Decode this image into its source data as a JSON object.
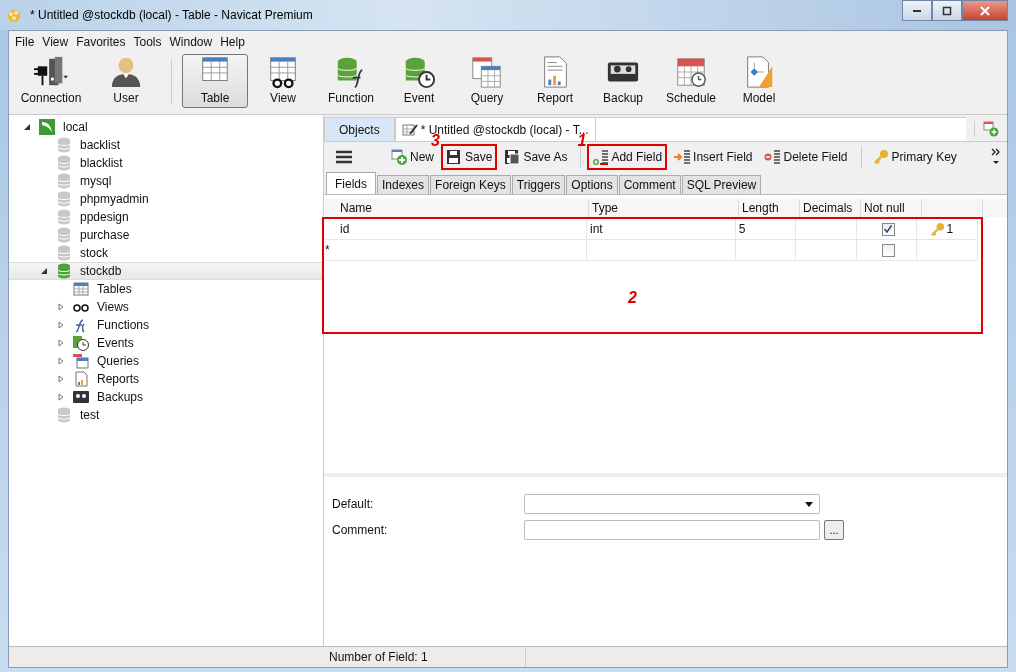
{
  "window": {
    "title": "* Untitled @stockdb (local) - Table - Navicat Premium"
  },
  "menu": [
    "File",
    "View",
    "Favorites",
    "Tools",
    "Window",
    "Help"
  ],
  "toolbar": [
    {
      "label": "Connection",
      "kind": "connection",
      "selected": false
    },
    {
      "label": "User",
      "kind": "user",
      "selected": false
    },
    {
      "label": "Table",
      "kind": "table",
      "selected": true
    },
    {
      "label": "View",
      "kind": "view",
      "selected": false
    },
    {
      "label": "Function",
      "kind": "function",
      "selected": false
    },
    {
      "label": "Event",
      "kind": "event",
      "selected": false
    },
    {
      "label": "Query",
      "kind": "query",
      "selected": false
    },
    {
      "label": "Report",
      "kind": "report",
      "selected": false
    },
    {
      "label": "Backup",
      "kind": "backup",
      "selected": false
    },
    {
      "label": "Schedule",
      "kind": "schedule",
      "selected": false
    },
    {
      "label": "Model",
      "kind": "model",
      "selected": false
    }
  ],
  "tree": [
    {
      "label": "local",
      "kind": "server",
      "expanded": true,
      "selected": false,
      "children": [
        {
          "label": "backlist",
          "kind": "database",
          "selected": false
        },
        {
          "label": "blacklist",
          "kind": "database",
          "selected": false
        },
        {
          "label": "mysql",
          "kind": "database",
          "selected": false
        },
        {
          "label": "phpmyadmin",
          "kind": "database",
          "selected": false
        },
        {
          "label": "ppdesign",
          "kind": "database",
          "selected": false
        },
        {
          "label": "purchase",
          "kind": "database",
          "selected": false
        },
        {
          "label": "stock",
          "kind": "database",
          "selected": false
        },
        {
          "label": "stockdb",
          "kind": "database-open",
          "expanded": true,
          "selected": true,
          "children": [
            {
              "label": "Tables",
              "kind": "tables",
              "selected": false
            },
            {
              "label": "Views",
              "kind": "views",
              "expanded": false,
              "selected": false
            },
            {
              "label": "Functions",
              "kind": "functions",
              "expanded": false,
              "selected": false
            },
            {
              "label": "Events",
              "kind": "events",
              "expanded": false,
              "selected": false
            },
            {
              "label": "Queries",
              "kind": "queries",
              "expanded": false,
              "selected": false
            },
            {
              "label": "Reports",
              "kind": "reports",
              "expanded": false,
              "selected": false
            },
            {
              "label": "Backups",
              "kind": "backups",
              "expanded": false,
              "selected": false
            }
          ]
        },
        {
          "label": "test",
          "kind": "database",
          "selected": false
        }
      ]
    }
  ],
  "doc_tabs": [
    {
      "label": "Objects",
      "selected": false
    },
    {
      "label": "* Untitled @stockdb (local) - T...",
      "selected": true
    }
  ],
  "editor_toolbar": [
    {
      "label": "New",
      "kind": "new",
      "separator_before": false
    },
    {
      "label": "Save",
      "kind": "save",
      "separator_before": false,
      "mark": "3"
    },
    {
      "label": "Save As",
      "kind": "save-as",
      "separator_before": false
    },
    {
      "label": "Add Field",
      "kind": "add-field",
      "separator_before": true,
      "mark": "1"
    },
    {
      "label": "Insert Field",
      "kind": "insert-field",
      "separator_before": false
    },
    {
      "label": "Delete Field",
      "kind": "delete-field",
      "separator_before": false
    },
    {
      "label": "Primary Key",
      "kind": "primary-key",
      "separator_before": true
    }
  ],
  "sub_tabs": [
    {
      "label": "Fields",
      "selected": true
    },
    {
      "label": "Indexes",
      "selected": false
    },
    {
      "label": "Foreign Keys",
      "selected": false
    },
    {
      "label": "Triggers",
      "selected": false
    },
    {
      "label": "Options",
      "selected": false
    },
    {
      "label": "Comment",
      "selected": false
    },
    {
      "label": "SQL Preview",
      "selected": false
    }
  ],
  "grid": {
    "columns": [
      "Name",
      "Type",
      "Length",
      "Decimals",
      "Not null"
    ],
    "mark": "2",
    "rows": [
      {
        "name": "id",
        "type": "int",
        "length": "5",
        "not_null": true,
        "primary_key": "1"
      },
      {
        "marker": "*",
        "not_null": false
      }
    ]
  },
  "properties": [
    {
      "label": "Default:",
      "kind": "dropdown"
    },
    {
      "label": "Comment:",
      "kind": "text",
      "button": "..."
    }
  ],
  "status_bar": "Number of Field: 1"
}
